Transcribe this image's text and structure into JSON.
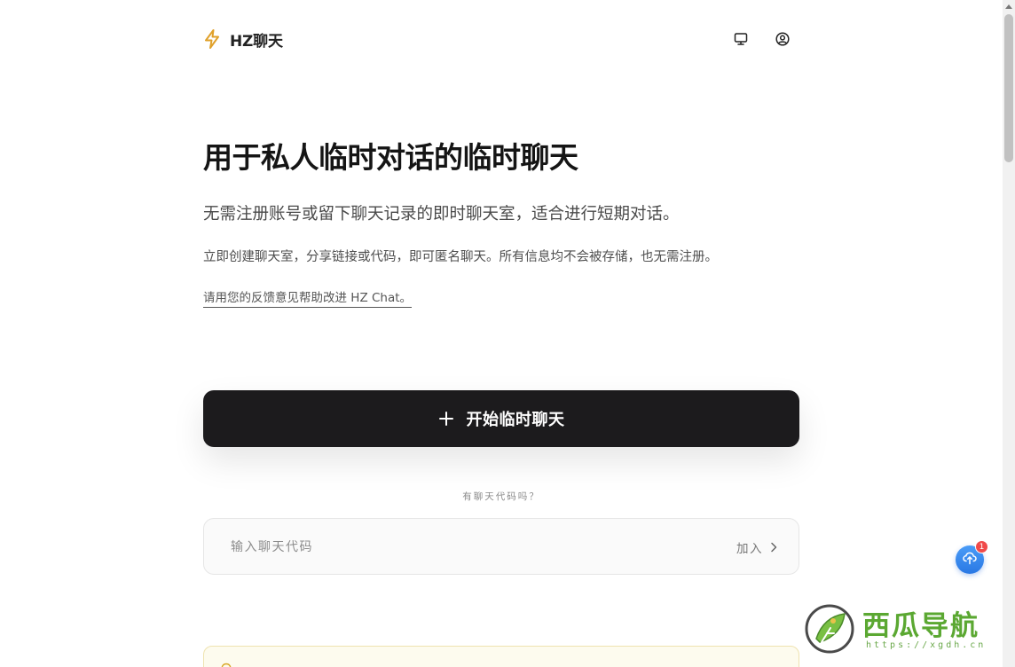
{
  "header": {
    "brand_name": "HZ聊天",
    "brand_icon": "lightning-icon",
    "accent_color": "#e8a32a",
    "monitor_icon": "monitor-icon",
    "account_icon": "user-circle-icon"
  },
  "hero": {
    "title": "用于私人临时对话的临时聊天",
    "subtitle": "无需注册账号或留下聊天记录的即时聊天室，适合进行短期对话。",
    "description": "立即创建聊天室，分享链接或代码，即可匿名聊天。所有信息均不会被存储，也无需注册。",
    "feedback_link": "请用您的反馈意见帮助改进 HZ Chat。"
  },
  "start_button": {
    "label": "开始临时聊天",
    "icon": "plus-icon"
  },
  "join": {
    "caption": "有聊天代码吗？",
    "placeholder": "输入聊天代码",
    "join_label": "加入",
    "join_icon": "chevron-right-icon"
  },
  "notice": {
    "icon": "lightbulb-icon",
    "text": ""
  },
  "floating": {
    "icon": "upload-cloud-icon",
    "badge": "1"
  },
  "watermark": {
    "text": "西瓜导航",
    "url": "https://xgdh.cn"
  }
}
